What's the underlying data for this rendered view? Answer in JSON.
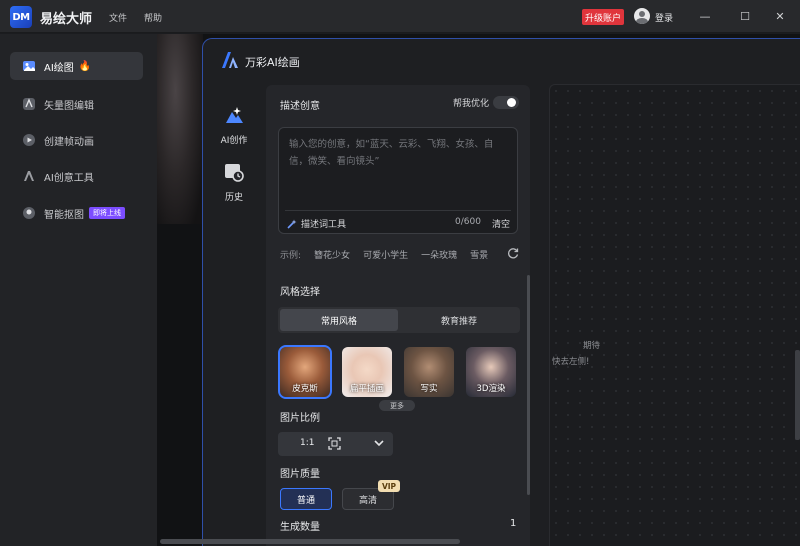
{
  "app": {
    "logo_text": "DM",
    "title": "易绘大师",
    "menu": {
      "file": "文件",
      "help": "帮助"
    },
    "upgrade_label": "升级账户",
    "login_label": "登录",
    "window_controls": {
      "minimize": "—",
      "maximize": "☐",
      "close": "✕"
    }
  },
  "sidebar": {
    "items": [
      {
        "label": "AI绘图",
        "icon": "image-icon",
        "active": true,
        "badge": "fire"
      },
      {
        "label": "矢量图编辑",
        "icon": "vector-icon"
      },
      {
        "label": "创建帧动画",
        "icon": "animation-icon"
      },
      {
        "label": "AI创意工具",
        "icon": "ai-tool-icon"
      },
      {
        "label": "智能抠图",
        "icon": "cutout-icon",
        "badge": "即将上线"
      }
    ]
  },
  "panel": {
    "title": "万彩AI绘画",
    "tools": [
      {
        "label": "AI创作",
        "icon": "ai-create-icon"
      },
      {
        "label": "历史",
        "icon": "history-icon"
      }
    ],
    "describe": {
      "title": "描述创意",
      "optimize_label": "帮我优化",
      "placeholder": "输入您的创意，如“蓝天、云彩、飞翔、女孩、自信，微笑、看向镜头”",
      "desc_tool_label": "描述词工具",
      "char_count": "0/600",
      "clear_label": "清空"
    },
    "examples": {
      "prefix": "示例:",
      "items": [
        "簪花少女",
        "可爱小学生",
        "一朵玫瑰",
        "雪景"
      ]
    },
    "style": {
      "title": "风格选择",
      "tabs": [
        "常用风格",
        "教育推荐"
      ],
      "thumbs": [
        "皮克斯",
        "扁平插画",
        "写实",
        "3D渲染"
      ],
      "more_label": "更多"
    },
    "ratio": {
      "title": "图片比例",
      "value": "1:1"
    },
    "quality": {
      "title": "图片质量",
      "options": [
        "普通",
        "高清"
      ],
      "vip_label": "VIP"
    },
    "count": {
      "title": "生成数量",
      "value": "1"
    }
  },
  "preview": {
    "hint_line1": "期待",
    "hint_line2": "快去左侧!"
  },
  "colors": {
    "accent": "#3b78ff",
    "upgrade": "#e0353c",
    "soon_badge": "#7c4dff",
    "vip": "#f2ddb1"
  }
}
